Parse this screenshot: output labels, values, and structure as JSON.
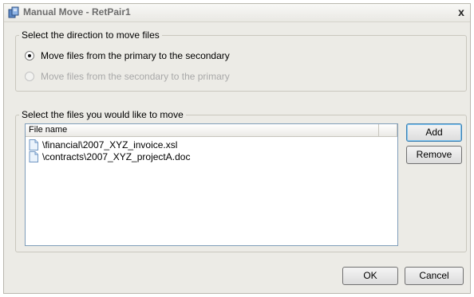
{
  "window": {
    "title": "Manual Move - RetPair1",
    "close_label": "x"
  },
  "direction_group": {
    "legend": "Select the direction to move files",
    "options": [
      {
        "label": "Move files from the primary to the secondary",
        "checked": true,
        "enabled": true
      },
      {
        "label": "Move files from the secondary to the primary",
        "checked": false,
        "enabled": false
      }
    ]
  },
  "files_group": {
    "legend": "Select the files you would like to move",
    "column_header": "File name",
    "files": [
      {
        "name": "\\financial\\2007_XYZ_invoice.xsl",
        "icon": "document-icon"
      },
      {
        "name": "\\contracts\\2007_XYZ_projectA.doc",
        "icon": "document-icon"
      }
    ],
    "add_label": "Add",
    "remove_label": "Remove"
  },
  "footer": {
    "ok_label": "OK",
    "cancel_label": "Cancel"
  }
}
